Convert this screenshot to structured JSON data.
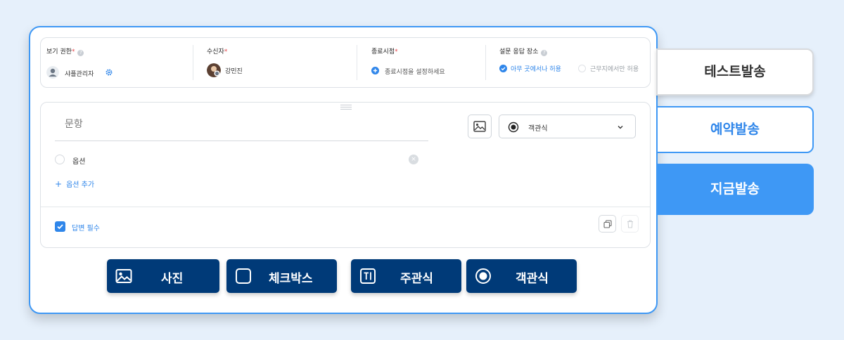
{
  "settings": {
    "view_permission": {
      "label": "보기 권한",
      "required_mark": "*",
      "user_name": "샤플관리자"
    },
    "recipient": {
      "label": "수신자",
      "required_mark": "*",
      "user_name": "강민진"
    },
    "end_time": {
      "label": "종료시점",
      "required_mark": "*",
      "placeholder": "종료시점을 설정하세요"
    },
    "response_place": {
      "label": "설문 응답 장소",
      "option_anywhere": "아무 곳에서나 허용",
      "option_work_only": "근무지에서만 허용",
      "selected": "아무 곳에서나 허용"
    }
  },
  "question": {
    "title_placeholder": "문항",
    "option_label": "옵션",
    "add_option_label": "옵션 추가",
    "type_selected": "객관식",
    "required_label": "답변 필수",
    "required_checked": true
  },
  "type_buttons": {
    "photo": "사진",
    "checkbox": "체크박스",
    "subjective": "주관식",
    "objective": "객관식"
  },
  "send_buttons": {
    "test": "테스트발송",
    "reserve": "예약발송",
    "now": "지금발송"
  },
  "colors": {
    "accent": "#3e98f5",
    "navy": "#003a78",
    "background": "#e6f0fb"
  }
}
